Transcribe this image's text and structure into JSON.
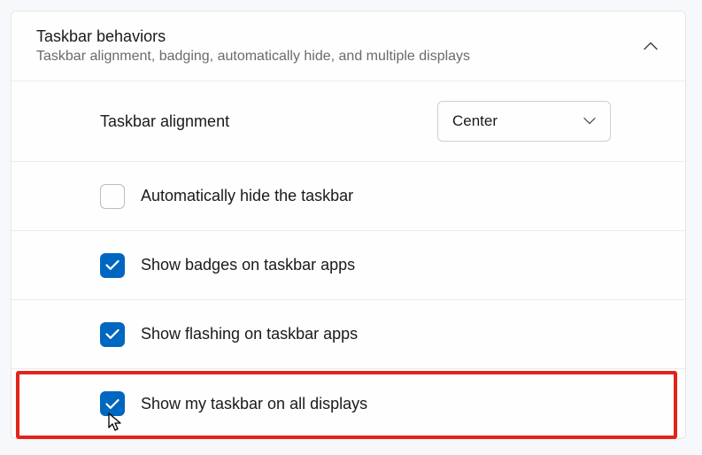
{
  "header": {
    "title": "Taskbar behaviors",
    "subtitle": "Taskbar alignment, badging, automatically hide, and multiple displays"
  },
  "alignment": {
    "label": "Taskbar alignment",
    "value": "Center"
  },
  "options": {
    "autohide": {
      "label": "Automatically hide the taskbar",
      "checked": false
    },
    "badges": {
      "label": "Show badges on taskbar apps",
      "checked": true
    },
    "flashing": {
      "label": "Show flashing on taskbar apps",
      "checked": true
    },
    "alldisplays": {
      "label": "Show my taskbar on all displays",
      "checked": true
    }
  }
}
